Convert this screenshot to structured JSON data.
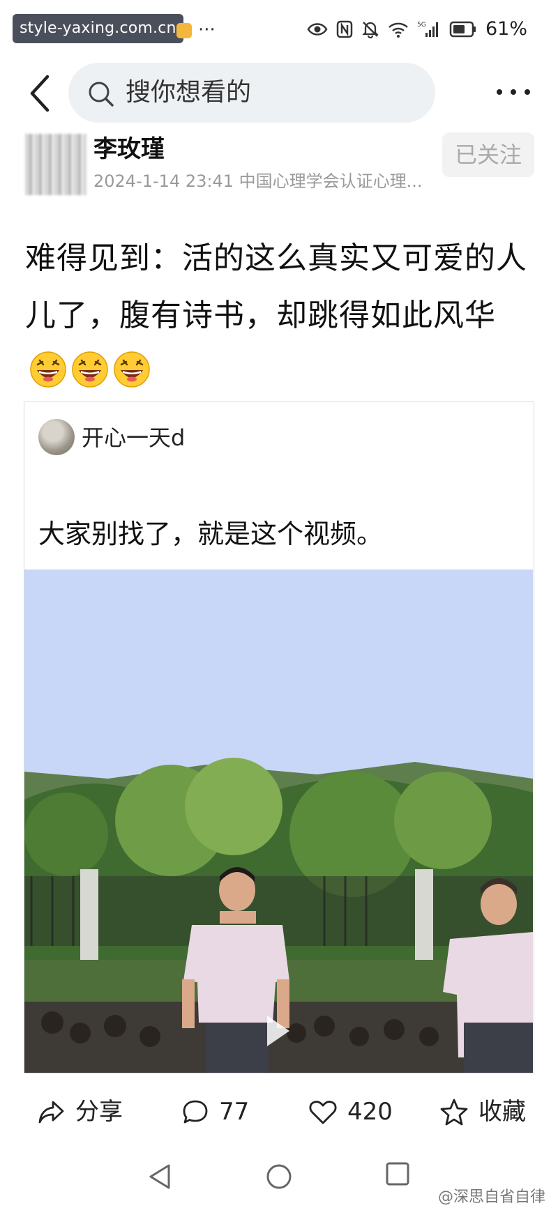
{
  "status_bar": {
    "watermark": "style-yaxing.com.cn",
    "more_dots": "···",
    "battery_percent": "61%"
  },
  "header": {
    "search_placeholder": "搜你想看的"
  },
  "author": {
    "name": "李玫瑾",
    "meta": "2024-1-14 23:41  中国心理学会认证心理...",
    "follow_label": "已关注"
  },
  "post": {
    "text": "难得见到：活的这么真实又可爱的人儿了，腹有诗书，却跳得如此风华",
    "emoji_count": 3,
    "emoji_icon": "laughing-emoji-icon"
  },
  "quote": {
    "author": "开心一天d",
    "text": "大家别找了，就是这个视频。"
  },
  "actions": {
    "share_label": "分享",
    "comment_count": "77",
    "like_count": "420",
    "favorite_label": "收藏"
  },
  "footer": {
    "watermark": "@深思自省自律"
  },
  "colors": {
    "sky": "#c8d6f7",
    "shirt": "#e9d9e4",
    "foliage": "#4f7a3a"
  }
}
